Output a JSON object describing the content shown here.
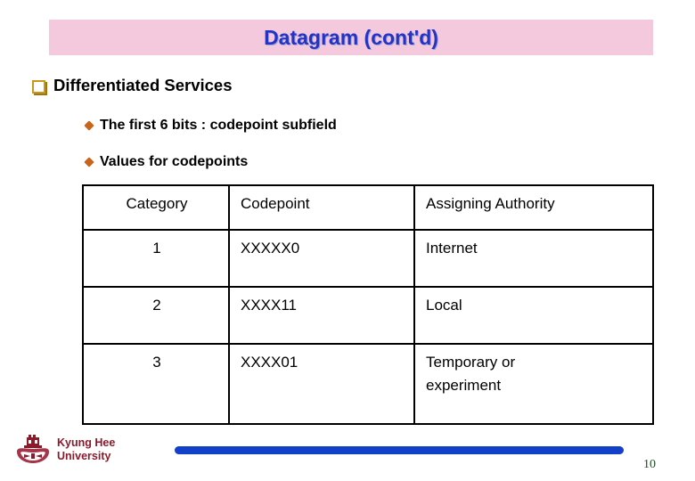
{
  "slide": {
    "title": "Datagram (cont'd)",
    "title_bg_color": "#f4c9dd",
    "title_text_color": "#2433c4",
    "page_number": "10"
  },
  "bullets": {
    "level1": {
      "marker": "hollow-square-bullet",
      "text": "Differentiated Services"
    },
    "level2": [
      {
        "marker": "diamond-bullet",
        "text": "The first 6 bits : codepoint subfield"
      },
      {
        "marker": "diamond-bullet",
        "text": "Values for codepoints"
      }
    ]
  },
  "table": {
    "headers": [
      "Category",
      "Codepoint",
      "Assigning Authority"
    ],
    "rows": [
      {
        "category": "1",
        "codepoint": "XXXXX0",
        "authority_line1": "Internet",
        "authority_line2": ""
      },
      {
        "category": "2",
        "codepoint": "XXXX11",
        "authority_line1": "Local",
        "authority_line2": ""
      },
      {
        "category": "3",
        "codepoint": "XXXX01",
        "authority_line1": "Temporary or",
        "authority_line2": "experiment"
      }
    ]
  },
  "footer": {
    "logo_line1": "Kyung Hee",
    "logo_line2": "University",
    "logo_color": "#8c1a2b",
    "bar_color": "#1240c8"
  }
}
